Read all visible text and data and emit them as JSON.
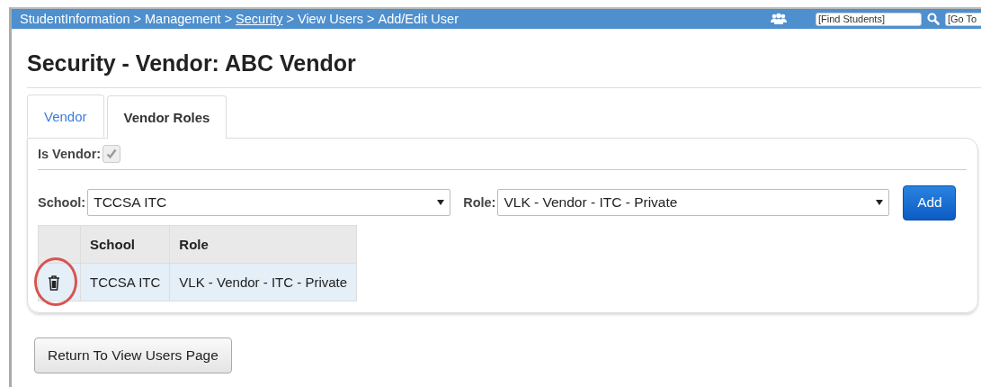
{
  "breadcrumb": [
    {
      "label": "StudentInformation",
      "kind": "text"
    },
    {
      "label": ">",
      "kind": "separator"
    },
    {
      "label": "Management",
      "kind": "text"
    },
    {
      "label": ">",
      "kind": "separator"
    },
    {
      "label": "Security",
      "kind": "link"
    },
    {
      "label": ">",
      "kind": "separator"
    },
    {
      "label": "View Users",
      "kind": "text"
    },
    {
      "label": ">",
      "kind": "separator"
    },
    {
      "label": "Add/Edit User",
      "kind": "text"
    }
  ],
  "header": {
    "find_students": {
      "value": "[Find Students]"
    },
    "go_to": {
      "value": "[Go To"
    }
  },
  "title": "Security - Vendor: ABC Vendor",
  "tabs": [
    {
      "label": "Vendor",
      "selected": false
    },
    {
      "label": "Vendor Roles",
      "selected": true
    }
  ],
  "is_vendor": {
    "label": "Is Vendor:",
    "checked": true,
    "disabled": true
  },
  "school": {
    "label": "School:",
    "value": "TCCSA ITC"
  },
  "role": {
    "label": "Role:",
    "value": "VLK - Vendor - ITC - Private"
  },
  "add_button": "Add",
  "table": {
    "columns": [
      "School",
      "Role"
    ],
    "rows": [
      {
        "cells": [
          "TCCSA ITC",
          "VLK - Vendor - ITC - Private"
        ],
        "highlighted": true
      }
    ]
  },
  "return_button": "Return To View Users Page"
}
